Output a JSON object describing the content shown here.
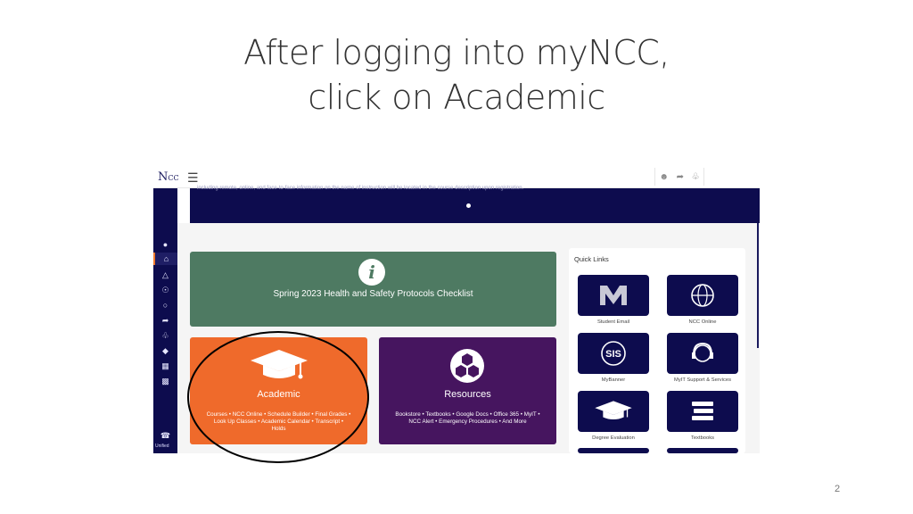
{
  "slide": {
    "title_line1": "After logging into myNCC,",
    "title_line2": "click on Academic",
    "page_number": "2"
  },
  "app": {
    "logo_text": "N",
    "logo_sub": "CC",
    "hamburger_glyph": "☰",
    "sidebar_bottom_label": "Unified",
    "banner_text": "including remote, online, and face-to-face information on the name of instruction will be located in the course description upon registration.",
    "cards": {
      "health": {
        "title": "Spring 2023 Health and Safety Protocols Checklist",
        "icon": "info-icon",
        "color": "#4e7a62"
      },
      "academic": {
        "title": "Academic",
        "description": "Courses • NCC Online • Schedule Builder • Final Grades • Look Up Classes • Academic Calendar • Transcript • Holds",
        "icon": "graduation-cap-icon",
        "color": "#ef6a2b"
      },
      "resources": {
        "title": "Resources",
        "description": "Bookstore • Textbooks • Google Docs • Office 365 • MyIT • NCC Alert • Emergency Procedures • And More",
        "icon": "hexagons-icon",
        "color": "#46155f"
      }
    },
    "quick_links": {
      "title": "Quick Links",
      "items": [
        {
          "label": "Student Email",
          "icon": "m-logo-icon"
        },
        {
          "label": "NCC Online",
          "icon": "globe-icon"
        },
        {
          "label": "MyBanner",
          "icon": "sis-icon"
        },
        {
          "label": "MyIT Support & Services",
          "icon": "headset-icon"
        },
        {
          "label": "Degree Evaluation",
          "icon": "graduation-cap-icon"
        },
        {
          "label": "Textbooks",
          "icon": "book-stack-icon"
        }
      ]
    },
    "colors": {
      "navy": "#0d0c4e",
      "accent_orange": "#f27a2b"
    }
  }
}
